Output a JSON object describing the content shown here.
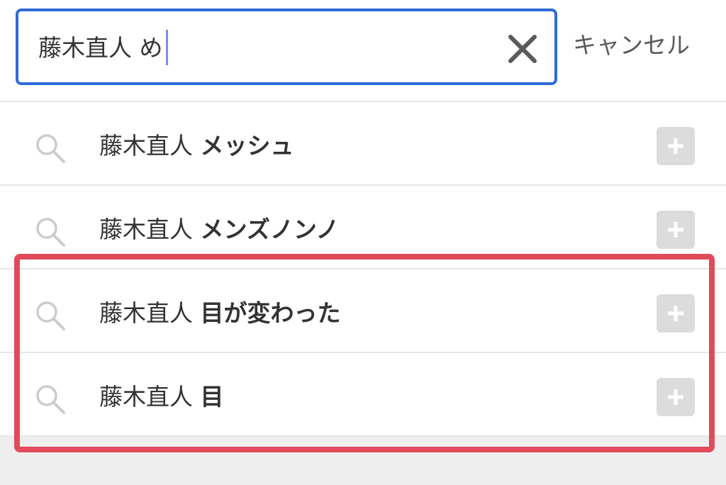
{
  "search": {
    "query": "藤木直人 め",
    "clear_icon": "close-icon",
    "cancel_label": "キャンセル"
  },
  "suggestions": [
    {
      "prefix": "藤木直人 ",
      "suffix": "メッシュ"
    },
    {
      "prefix": "藤木直人 ",
      "suffix": "メンズノンノ"
    },
    {
      "prefix": "藤木直人 ",
      "suffix": "目が変わった"
    },
    {
      "prefix": "藤木直人 ",
      "suffix": "目"
    }
  ],
  "colors": {
    "search_border": "#2f6bd8",
    "highlight_box": "#e04a5a",
    "add_button_bg": "#dcdcdc"
  }
}
